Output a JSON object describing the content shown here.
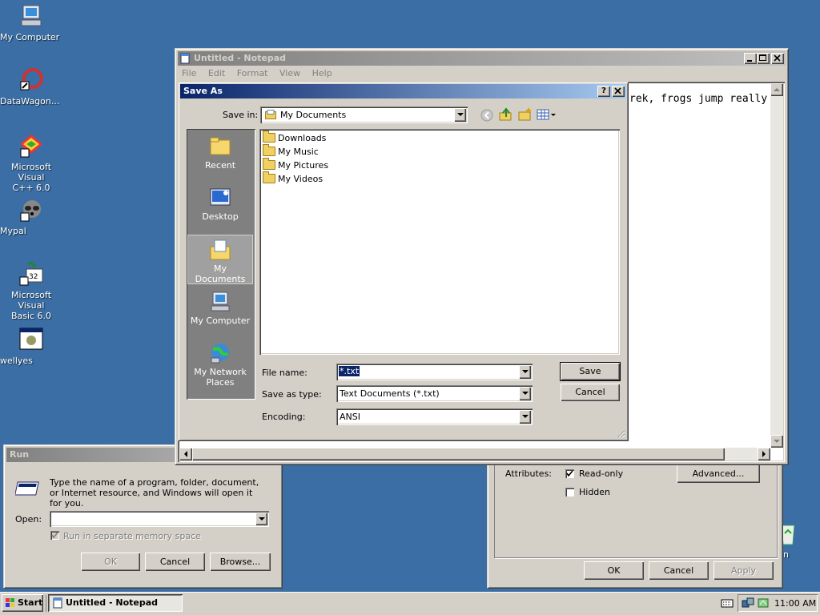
{
  "desktop": {
    "icons": [
      {
        "label": "My Computer",
        "icon": "my-computer-icon"
      },
      {
        "label": "DataWagon...",
        "icon": "datawagon-icon"
      },
      {
        "label": "Microsoft Visual\nC++ 6.0",
        "icon": "visual-cpp-icon"
      },
      {
        "label": "Mypal",
        "icon": "mypal-icon"
      },
      {
        "label": "Microsoft Visual\nBasic 6.0",
        "icon": "visual-basic-icon"
      },
      {
        "label": "wellyes",
        "icon": "wellyes-icon"
      },
      {
        "label": "cle Bin",
        "icon": "recycle-bin-icon"
      }
    ]
  },
  "notepad": {
    "title": "Untitled - Notepad",
    "menu": [
      "File",
      "Edit",
      "Format",
      "View",
      "Help"
    ],
    "text": "rek, frogs jump really"
  },
  "save_as": {
    "title": "Save As",
    "help_glyph": "?",
    "close_glyph": "×",
    "save_in_label": "Save in:",
    "save_in_value": "My Documents",
    "places": [
      "Recent",
      "Desktop",
      "My Documents",
      "My Computer",
      "My Network Places"
    ],
    "files": [
      "Downloads",
      "My Music",
      "My Pictures",
      "My Videos"
    ],
    "file_name_label": "File name:",
    "file_name_value": "*.txt",
    "save_type_label": "Save as type:",
    "save_type_value": "Text Documents (*.txt)",
    "encoding_label": "Encoding:",
    "encoding_value": "ANSI",
    "save_button": "Save",
    "cancel_button": "Cancel"
  },
  "run": {
    "title": "Run",
    "description": "Type the name of a program, folder, document, or Internet resource, and Windows will open it for you.",
    "open_label": "Open:",
    "open_value": "",
    "separate_memory": "Run in separate memory space",
    "ok": "OK",
    "cancel": "Cancel",
    "browse": "Browse..."
  },
  "properties": {
    "attributes_label": "Attributes:",
    "readonly_label": "Read-only",
    "hidden_label": "Hidden",
    "advanced_button": "Advanced...",
    "ok": "OK",
    "cancel": "Cancel",
    "apply": "Apply"
  },
  "taskbar": {
    "start": "Start",
    "task": "Untitled - Notepad",
    "clock": "11:00 AM"
  }
}
